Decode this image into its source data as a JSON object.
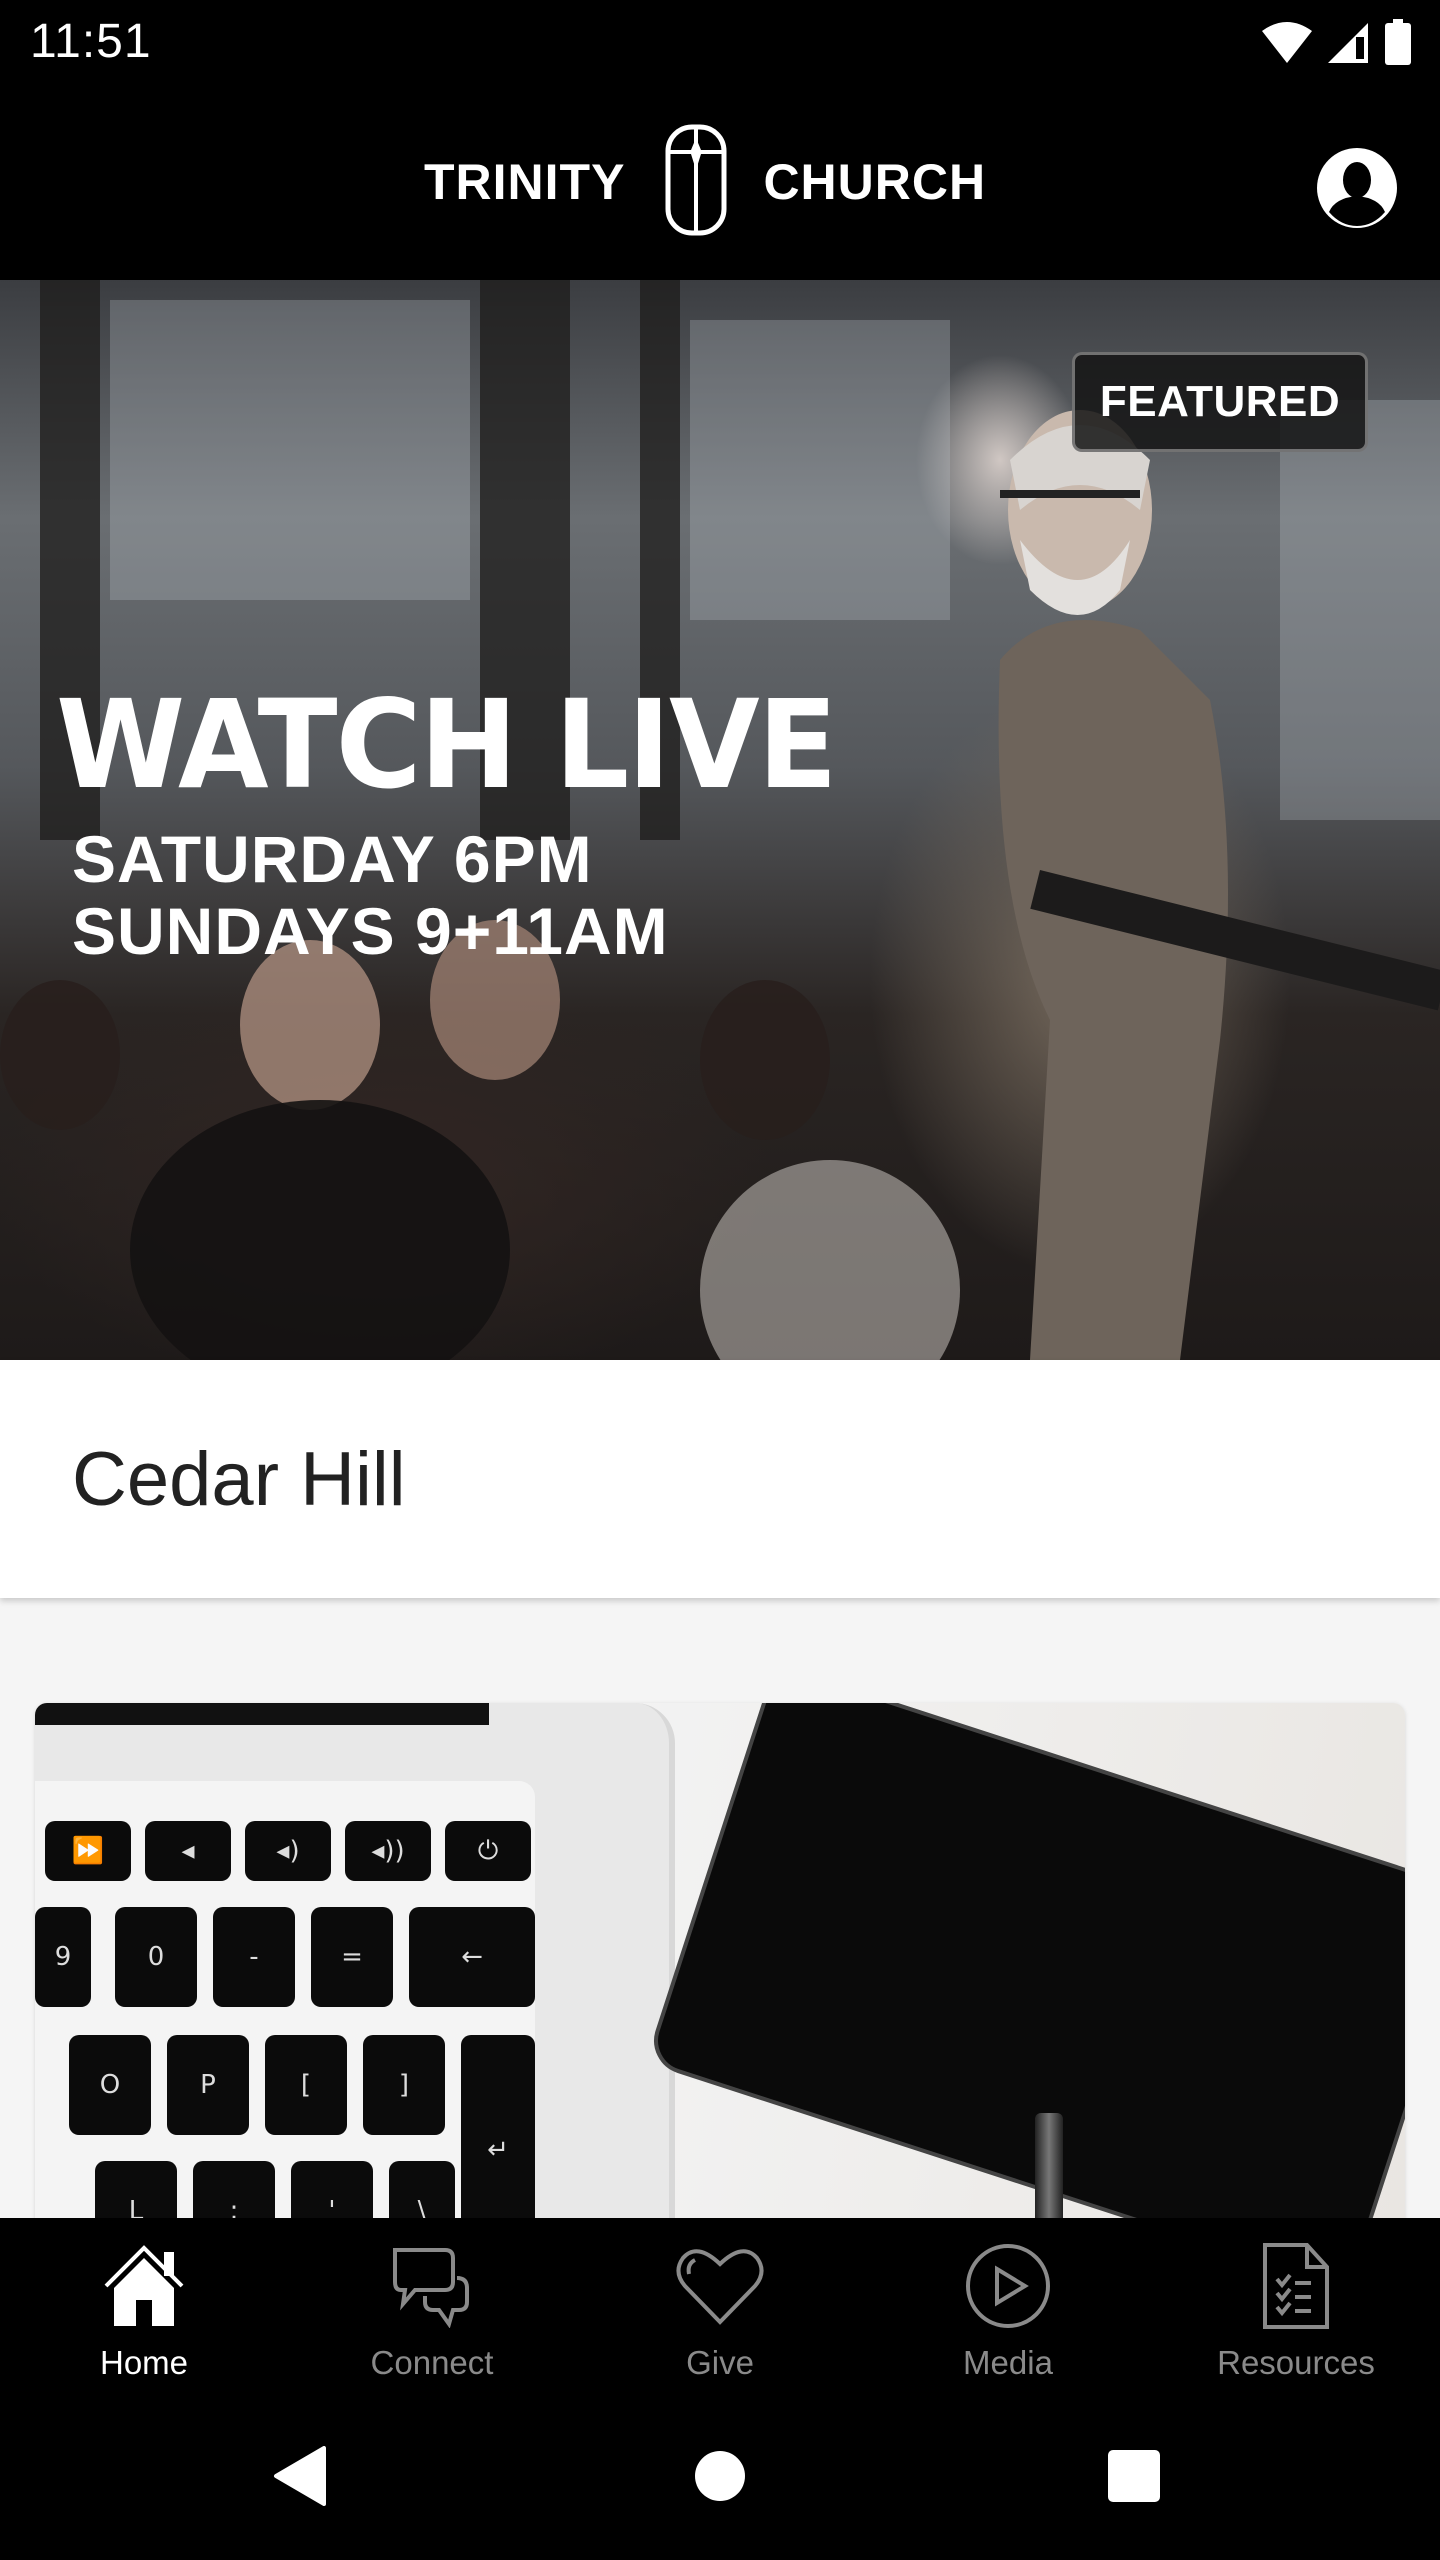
{
  "status_bar": {
    "time": "11:51",
    "icons": [
      "wifi-icon",
      "cellular-signal-icon",
      "battery-icon"
    ]
  },
  "header": {
    "logo_left": "TRINITY",
    "logo_right": "CHURCH",
    "logo_icon": "cross-emblem-icon",
    "profile_icon": "account-circle-icon"
  },
  "hero": {
    "badge": "FEATURED",
    "title": "WATCH LIVE",
    "subtitle_line1": "SATURDAY 6PM",
    "subtitle_line2": "SUNDAYS 9+11AM"
  },
  "location": {
    "name": "Cedar Hill"
  },
  "media_card": {
    "image_description": "laptop-keyboard-and-phone"
  },
  "bottom_nav": {
    "active_color": "#ffffff",
    "inactive_color": "#8a8a8a",
    "items": [
      {
        "label": "Home",
        "icon": "home-icon",
        "active": true
      },
      {
        "label": "Connect",
        "icon": "chat-bubbles-icon",
        "active": false
      },
      {
        "label": "Give",
        "icon": "heart-icon",
        "active": false
      },
      {
        "label": "Media",
        "icon": "play-circle-icon",
        "active": false
      },
      {
        "label": "Resources",
        "icon": "checklist-document-icon",
        "active": false
      }
    ]
  },
  "system_nav": {
    "buttons": [
      "back-icon",
      "home-circle-icon",
      "recents-icon"
    ]
  }
}
